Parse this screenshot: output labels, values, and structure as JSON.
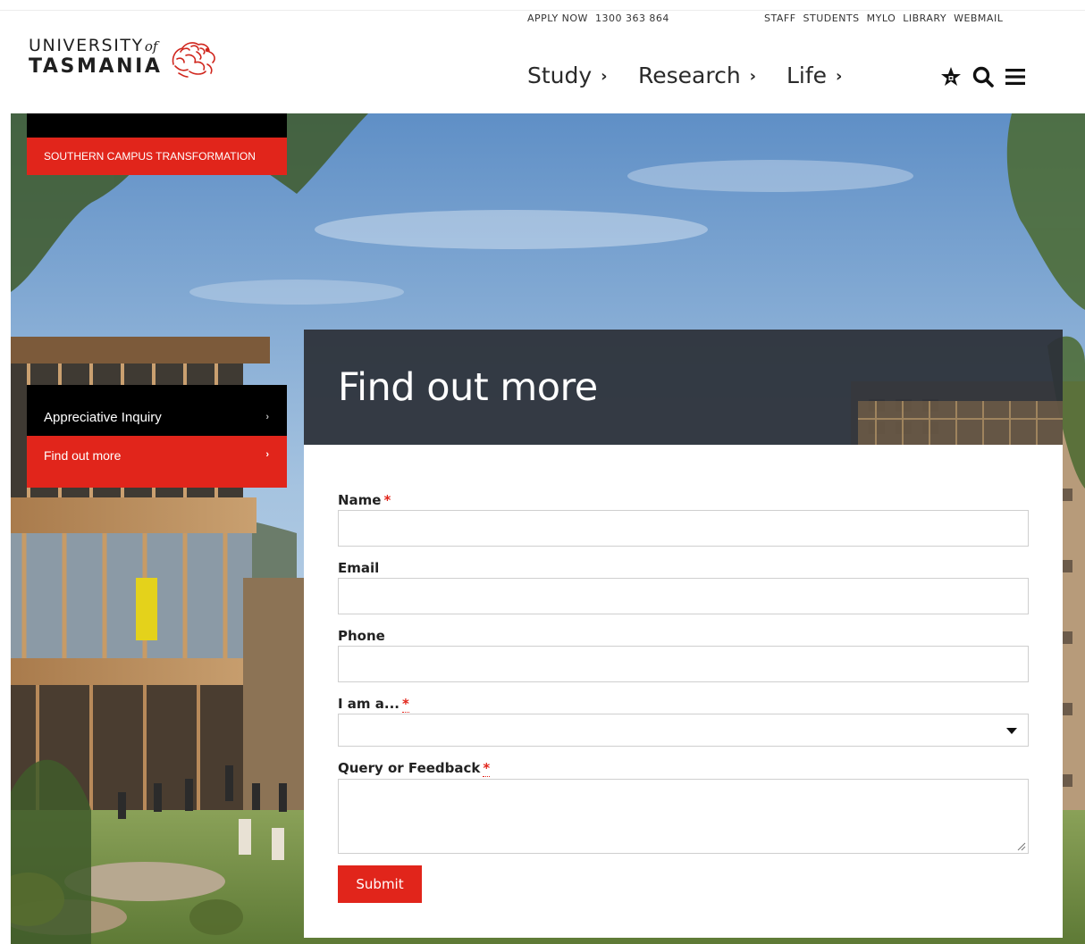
{
  "header": {
    "logo": {
      "line1": "UNIVERSITY",
      "of": "of",
      "line2": "TASMANIA"
    },
    "utility_left": [
      "APPLY NOW",
      "1300 363 864"
    ],
    "utility_right": [
      "STAFF",
      "STUDENTS",
      "MYLO",
      "LIBRARY",
      "WEBMAIL"
    ],
    "main_nav": [
      {
        "label": "Study",
        "chevron": "›"
      },
      {
        "label": "Research",
        "chevron": "›"
      },
      {
        "label": "Life",
        "chevron": "›"
      }
    ],
    "icons": [
      "star-icon",
      "search-icon",
      "menu-icon"
    ]
  },
  "sidebar": {
    "section_label": "SOUTHERN CAMPUS TRANSFORMATION",
    "items": [
      {
        "label": "Appreciative Inquiry",
        "arrow": "›"
      },
      {
        "label": "Find out more",
        "arrow": "›",
        "active": true
      }
    ]
  },
  "main": {
    "title": "Find out more",
    "form": {
      "fields": [
        {
          "label": "Name",
          "required": true,
          "type": "text",
          "value": ""
        },
        {
          "label": "Email",
          "required": false,
          "type": "text",
          "value": ""
        },
        {
          "label": "Phone",
          "required": false,
          "type": "text",
          "value": ""
        },
        {
          "label": "I am a...",
          "required": true,
          "type": "select",
          "value": ""
        },
        {
          "label": "Query or Feedback",
          "required": true,
          "type": "textarea",
          "value": ""
        }
      ],
      "required_marker": "*",
      "submit_label": "Submit"
    }
  },
  "colors": {
    "accent_red": "#e1251b",
    "panel_dark": "#2c3038",
    "nav_black": "#000000"
  }
}
